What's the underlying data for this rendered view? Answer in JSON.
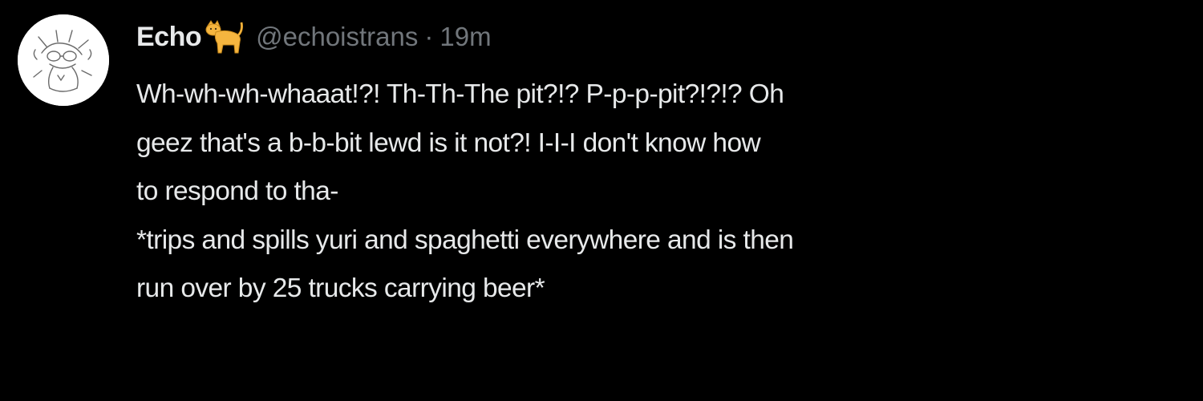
{
  "tweet": {
    "display_name": "Echo",
    "name_emoji": "cat-icon",
    "handle": "@echoistrans",
    "separator": "·",
    "time": "19m",
    "lines": [
      "Wh-wh-wh-whaaat!?! Th-Th-The pit?!? P-p-p-pit?!?!? Oh",
      "geez that's a b-b-bit lewd is it not?! I-I-I don't know how",
      "to respond to tha-",
      "*trips and spills yuri and spaghetti everywhere and is then",
      "run over by 25 trucks carrying beer*"
    ]
  },
  "colors": {
    "background": "#000000",
    "primary_text": "#e7e9ea",
    "secondary_text": "#71767b",
    "emoji_fill": "#f5b53f"
  }
}
